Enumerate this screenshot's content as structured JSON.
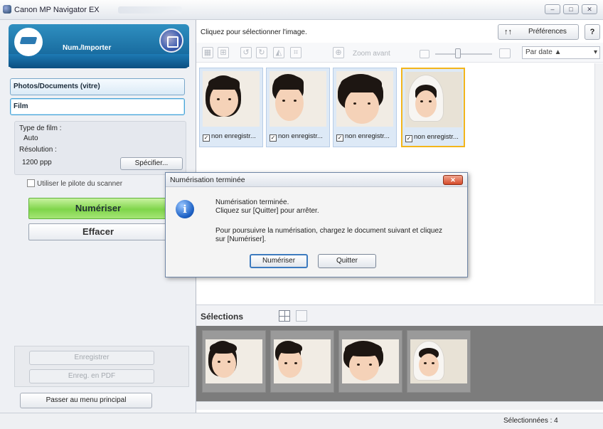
{
  "window": {
    "title": "Canon MP Navigator EX",
    "controls": {
      "minimize": "–",
      "maximize": "□",
      "close": "✕"
    }
  },
  "left_panel": {
    "mode_label": "Num./Importer",
    "sources": [
      {
        "label": "Photos/Documents (vitre)",
        "active": false
      },
      {
        "label": "Film",
        "active": true
      }
    ],
    "settings": {
      "film_type_label": "Type de film :",
      "film_type_value": "Auto",
      "resolution_label": "Résolution :",
      "resolution_value": "1200 ppp",
      "specify_button": "Spécifier..."
    },
    "scanner_driver_checkbox": "Utiliser le pilote du scanner",
    "scan_button": "Numériser",
    "clear_button": "Effacer",
    "save_button": "Enregistrer",
    "save_pdf_button": "Enreg. en PDF",
    "main_menu_button": "Passer au menu principal"
  },
  "right_panel": {
    "hint": "Cliquez pour sélectionner l'image.",
    "preferences_button": "Préférences",
    "help_button": "?",
    "toolbar": {
      "zoom_label": "Zoom avant",
      "sort_value": "Par date ▲",
      "sort_arrow": "▾"
    },
    "thumbnails": [
      {
        "caption": "non enregistr...",
        "selected": false
      },
      {
        "caption": "non enregistr...",
        "selected": false
      },
      {
        "caption": "non enregistr...",
        "selected": false
      },
      {
        "caption": "non enregistr...",
        "selected": true
      }
    ],
    "selections_label": "Sélections",
    "status_text": "Sélectionnées : 4"
  },
  "dialog": {
    "title": "Numérisation terminée",
    "line1": "Numérisation terminée.",
    "line2": "Cliquez sur [Quitter] pour arrêter.",
    "line3": "Pour poursuivre la numérisation, chargez le document suivant et cliquez",
    "line4": "sur [Numériser].",
    "scan_button": "Numériser",
    "quit_button": "Quitter",
    "close_glyph": "✕",
    "info_glyph": "i"
  },
  "colors": {
    "accent_blue": "#0f5d92",
    "scan_green": "#7fd54a",
    "selection_gold": "#f3b51b"
  }
}
